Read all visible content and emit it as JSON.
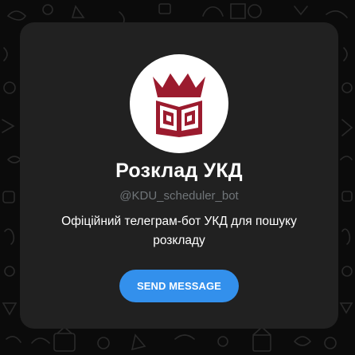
{
  "profile": {
    "name": "Розклад УКД",
    "username": "@KDU_scheduler_bot",
    "description": "Офіційний телеграм-бот УКД для пошуку розкладу",
    "avatar_icon": "crown-book-logo-icon",
    "logo_color": "#9b1b2e"
  },
  "actions": {
    "send_label": "SEND MESSAGE",
    "accent": "#3390ec"
  },
  "background": {
    "pattern": "doodle-pattern"
  }
}
